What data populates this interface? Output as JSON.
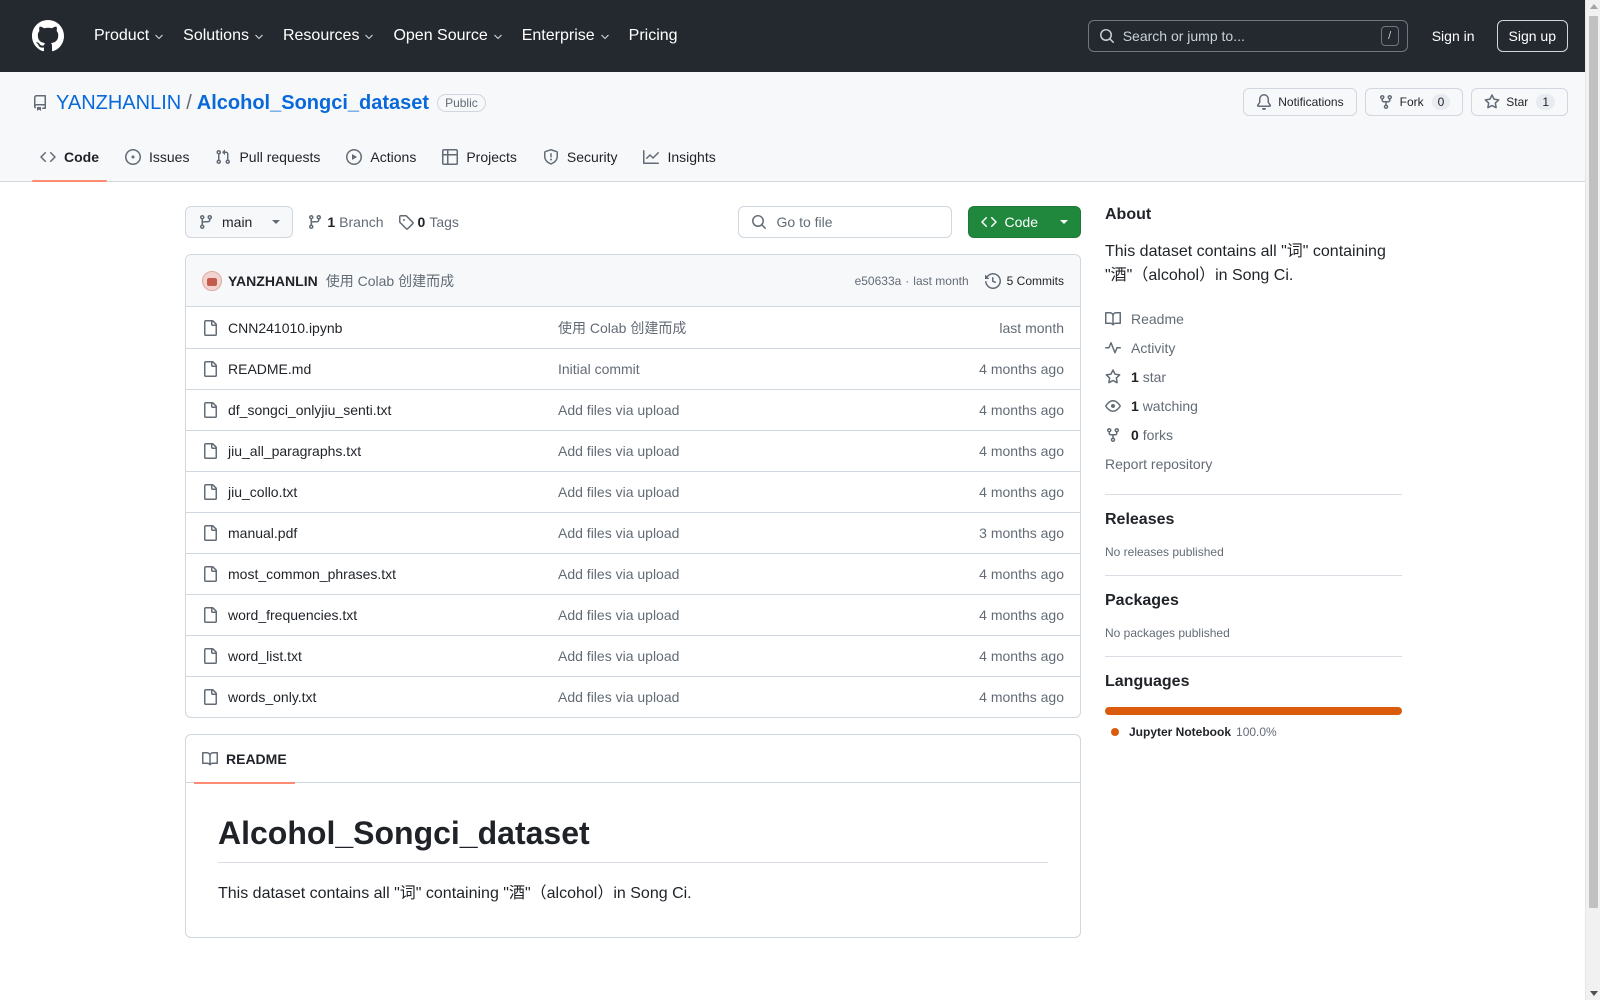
{
  "header": {
    "nav": [
      {
        "label": "Product",
        "dropdown": true
      },
      {
        "label": "Solutions",
        "dropdown": true
      },
      {
        "label": "Resources",
        "dropdown": true
      },
      {
        "label": "Open Source",
        "dropdown": true
      },
      {
        "label": "Enterprise",
        "dropdown": true
      },
      {
        "label": "Pricing",
        "dropdown": false
      }
    ],
    "search_placeholder": "Search or jump to...",
    "search_shortcut": "/",
    "signin": "Sign in",
    "signup": "Sign up"
  },
  "repo": {
    "owner": "YANZHANLIN",
    "separator": "/",
    "name": "Alcohol_Songci_dataset",
    "visibility": "Public",
    "actions": {
      "notifications": "Notifications",
      "fork": "Fork",
      "fork_count": "0",
      "star": "Star",
      "star_count": "1"
    },
    "tabs": [
      {
        "label": "Code",
        "icon": "code-icon",
        "active": true
      },
      {
        "label": "Issues",
        "icon": "issue-icon",
        "active": false
      },
      {
        "label": "Pull requests",
        "icon": "pull-request-icon",
        "active": false
      },
      {
        "label": "Actions",
        "icon": "play-icon",
        "active": false
      },
      {
        "label": "Projects",
        "icon": "table-icon",
        "active": false
      },
      {
        "label": "Security",
        "icon": "shield-icon",
        "active": false
      },
      {
        "label": "Insights",
        "icon": "graph-icon",
        "active": false
      }
    ]
  },
  "toolbar": {
    "branch": "main",
    "branch_count": "1",
    "branch_label": "Branch",
    "tag_count": "0",
    "tag_label": "Tags",
    "goto_placeholder": "Go to file",
    "code_button": "Code"
  },
  "latest_commit": {
    "author": "YANZHANLIN",
    "message": "使用 Colab 创建而成",
    "hash": "e50633a",
    "dot": "·",
    "time": "last month",
    "commits_label": "5 Commits"
  },
  "files": [
    {
      "name": "CNN241010.ipynb",
      "message": "使用 Colab 创建而成",
      "age": "last month"
    },
    {
      "name": "README.md",
      "message": "Initial commit",
      "age": "4 months ago"
    },
    {
      "name": "df_songci_onlyjiu_senti.txt",
      "message": "Add files via upload",
      "age": "4 months ago"
    },
    {
      "name": "jiu_all_paragraphs.txt",
      "message": "Add files via upload",
      "age": "4 months ago"
    },
    {
      "name": "jiu_collo.txt",
      "message": "Add files via upload",
      "age": "4 months ago"
    },
    {
      "name": "manual.pdf",
      "message": "Add files via upload",
      "age": "3 months ago"
    },
    {
      "name": "most_common_phrases.txt",
      "message": "Add files via upload",
      "age": "4 months ago"
    },
    {
      "name": "word_frequencies.txt",
      "message": "Add files via upload",
      "age": "4 months ago"
    },
    {
      "name": "word_list.txt",
      "message": "Add files via upload",
      "age": "4 months ago"
    },
    {
      "name": "words_only.txt",
      "message": "Add files via upload",
      "age": "4 months ago"
    }
  ],
  "readme": {
    "tab_label": "README",
    "title": "Alcohol_Songci_dataset",
    "text": "This dataset contains all \"词\" containing \"酒\"（alcohol）in Song Ci."
  },
  "sidebar": {
    "about_title": "About",
    "description": "This dataset contains all \"词\" containing \"酒\"（alcohol）in Song Ci.",
    "links": [
      {
        "icon": "book-icon",
        "count": "",
        "label": "Readme"
      },
      {
        "icon": "pulse-icon",
        "count": "",
        "label": "Activity"
      },
      {
        "icon": "star-icon",
        "count": "1",
        "label": "star"
      },
      {
        "icon": "eye-icon",
        "count": "1",
        "label": "watching"
      },
      {
        "icon": "fork-icon",
        "count": "0",
        "label": "forks"
      }
    ],
    "report": "Report repository",
    "releases_title": "Releases",
    "releases_text": "No releases published",
    "packages_title": "Packages",
    "packages_text": "No packages published",
    "languages_title": "Languages",
    "languages": [
      {
        "name": "Jupyter Notebook",
        "percent": "100.0%",
        "share": 1.0,
        "color": "#da5b0b"
      }
    ]
  }
}
